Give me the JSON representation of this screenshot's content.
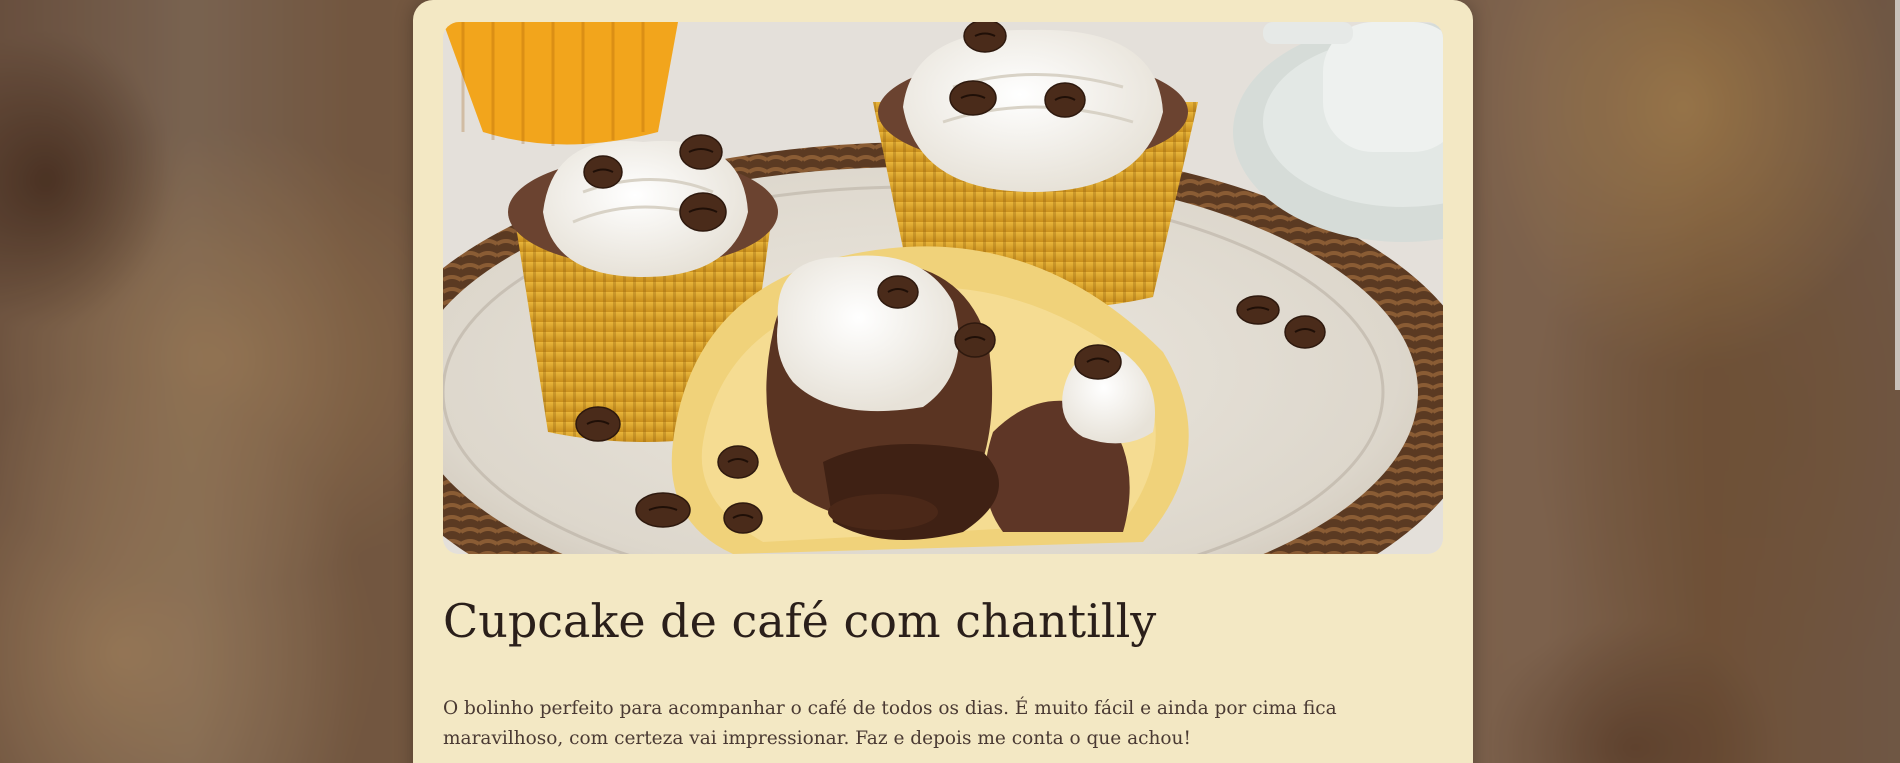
{
  "recipe": {
    "image_alt": "Cupcakes de café com chantilly e grãos de café",
    "title": "Cupcake de café com chantilly",
    "description": "O bolinho perfeito para acompanhar o café de todos os dias. É muito fácil e ainda por cima fica maravilhoso, com certeza vai impressionar. Faz e depois me conta o que achou!"
  },
  "colors": {
    "card_background": "#f3e8c4",
    "title_text": "#2a1f1a",
    "body_text": "#4a3a33"
  }
}
